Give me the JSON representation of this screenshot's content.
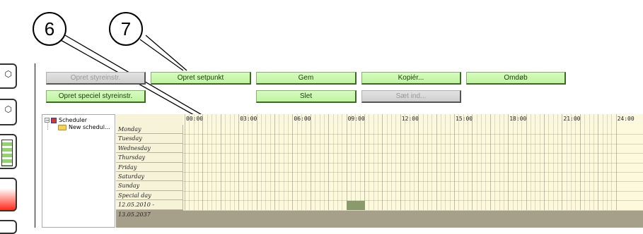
{
  "callouts": [
    {
      "id": "6",
      "label": "6"
    },
    {
      "id": "7",
      "label": "7"
    }
  ],
  "buttons_row1": [
    {
      "label": "Opret styreinstr.",
      "enabled": false
    },
    {
      "label": "Opret setpunkt",
      "enabled": true
    },
    {
      "label": "Gem",
      "enabled": true
    },
    {
      "label": "Kopiér...",
      "enabled": true
    },
    {
      "label": "Omdøb",
      "enabled": true
    }
  ],
  "buttons_row2": [
    {
      "label": "Opret speciel styreinstr.",
      "enabled": true
    },
    {
      "label": "Slet",
      "enabled": true
    },
    {
      "label": "Sæt ind...",
      "enabled": false
    }
  ],
  "tree": {
    "root": "Scheduler",
    "child": "New schedul..."
  },
  "grid": {
    "hours": [
      "00:00",
      "03:00",
      "06:00",
      "09:00",
      "12:00",
      "15:00",
      "18:00",
      "21:00",
      "24:00"
    ],
    "days": [
      "Monday",
      "Tuesday",
      "Wednesday",
      "Thursday",
      "Friday",
      "Saturday",
      "Sunday",
      "Special day",
      "12.05.2010 - 13.05.2037"
    ],
    "highlight": {
      "row": "12.05.2010 - 13.05.2037",
      "start_hour": 9.0,
      "end_hour": 10.0
    }
  },
  "colors": {
    "button_green": "#c8f7ab",
    "button_disabled": "#d9d9d9",
    "grid_background": "#fcf9dd",
    "grid_border": "#a6a08a",
    "highlight_block": "#8a9a6c"
  }
}
